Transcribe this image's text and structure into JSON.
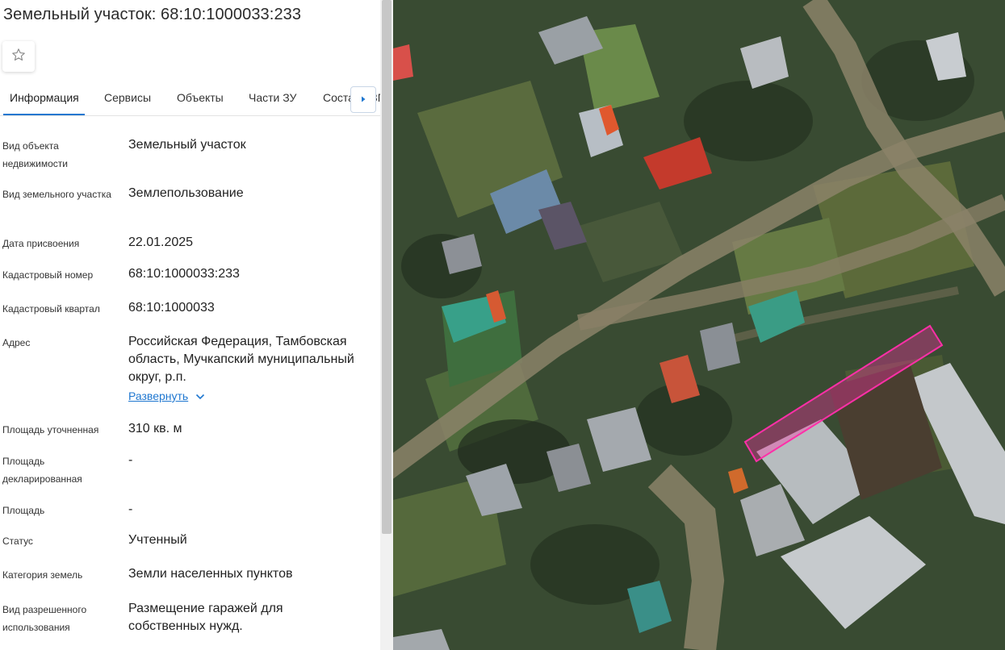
{
  "header": {
    "title": "Земельный участок: 68:10:1000033:233"
  },
  "tabs": [
    {
      "label": "Информация",
      "active": true
    },
    {
      "label": "Сервисы",
      "active": false
    },
    {
      "label": "Объекты",
      "active": false
    },
    {
      "label": "Части ЗУ",
      "active": false
    },
    {
      "label": "Состав ЕЗП",
      "active": false
    }
  ],
  "fields": [
    {
      "label": "Вид объекта недвижимости",
      "value": "Земельный участок"
    },
    {
      "label": "Вид земельного участка",
      "value": "Землепользование"
    },
    {
      "label": "Дата присвоения",
      "value": "22.01.2025"
    },
    {
      "label": "Кадастровый номер",
      "value": "68:10:1000033:233"
    },
    {
      "label": "Кадастровый квартал",
      "value": "68:10:1000033"
    },
    {
      "label": "Адрес",
      "value": "Российская Федерация, Тамбовская область, Мучкапский муниципальный округ, р.п."
    },
    {
      "label": "Площадь уточненная",
      "value": "310 кв. м"
    },
    {
      "label": "Площадь декларированная",
      "value": "-"
    },
    {
      "label": "Площадь",
      "value": "-"
    },
    {
      "label": "Статус",
      "value": "Учтенный"
    },
    {
      "label": "Категория земель",
      "value": "Земли населенных пунктов"
    },
    {
      "label": "Вид разрешенного использования",
      "value": "Размещение гаражей для собственных нужд."
    }
  ],
  "address_expand": "Развернуть",
  "icons": {
    "favorite": "star-outline-icon",
    "tabs_scroll": "chevron-right-icon",
    "expand": "chevron-down-icon"
  },
  "colors": {
    "accent": "#1f77d0",
    "parcel_outline": "#ff2fa8"
  }
}
